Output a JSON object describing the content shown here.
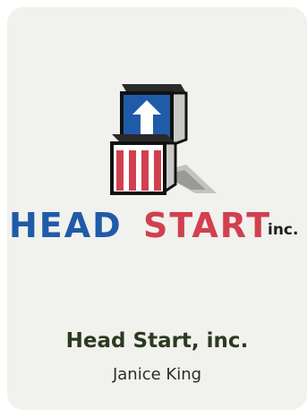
{
  "logo": {
    "wordmark_head": "HEAD",
    "wordmark_start": "START",
    "wordmark_inc": "inc.",
    "icon": "stacked-blocks-logo-icon",
    "colors": {
      "blue": "#1f5ba8",
      "red": "#d1404f",
      "dark": "#1e1e1e"
    }
  },
  "card": {
    "title": "Head Start, inc.",
    "subtitle": "Janice King"
  }
}
